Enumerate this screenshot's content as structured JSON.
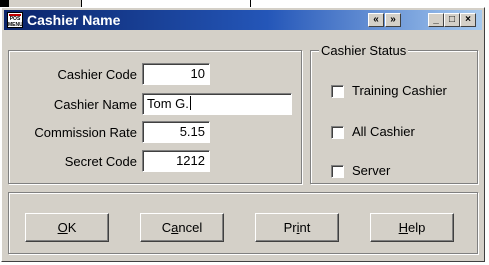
{
  "window": {
    "title": "Cashier Name",
    "app_icon": "pos-app-icon",
    "title_buttons": {
      "prev": "«",
      "next": "»",
      "minimize": "_",
      "maximize": "□",
      "close": "×"
    }
  },
  "fields": {
    "cashier_code": {
      "label": "Cashier Code",
      "value": "10"
    },
    "cashier_name": {
      "label": "Cashier Name",
      "value": "Tom G."
    },
    "commission_rate": {
      "label": "Commission Rate",
      "value": "5.15"
    },
    "secret_code": {
      "label": "Secret Code",
      "value": "1212"
    }
  },
  "cashier_status": {
    "title": "Cashier Status",
    "options": [
      {
        "label": "Training Cashier",
        "checked": false
      },
      {
        "label": "All Cashier",
        "checked": false
      },
      {
        "label": "Server",
        "checked": false
      }
    ]
  },
  "buttons": {
    "ok": {
      "pre": "",
      "mn": "O",
      "post": "K"
    },
    "cancel": {
      "pre": "C",
      "mn": "a",
      "post": "ncel"
    },
    "print": {
      "pre": "Pr",
      "mn": "i",
      "post": "nt"
    },
    "help": {
      "pre": "",
      "mn": "H",
      "post": "elp"
    }
  }
}
